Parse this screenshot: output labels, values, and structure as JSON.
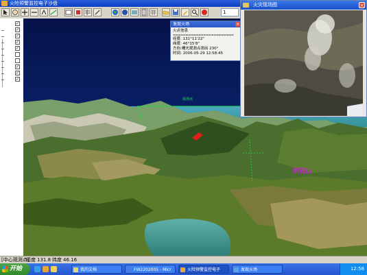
{
  "window": {
    "title": "火险预警监控电子沙盘"
  },
  "toolbar": {
    "zoom_value": "1",
    "icons": [
      "pointer-icon",
      "pan-icon",
      "zoom-in-icon",
      "zoom-out-icon",
      "rotate-icon",
      "measure-icon",
      "identify-icon",
      "select-icon",
      "globe-icon",
      "layers-icon",
      "photo-icon",
      "print-icon",
      "open-icon",
      "save-icon",
      "search-icon",
      "fly-icon",
      "record-icon",
      "help-icon"
    ]
  },
  "popup": {
    "title": "发现火场",
    "heading": "火点信息",
    "lines": [
      "经度: 131°11'22\"",
      "纬度: 46°15'8\"",
      "方向:曙光观测点测出 230°",
      "时间: 2006-05-29 12:58:45"
    ],
    "separator": "========================"
  },
  "photo_window": {
    "title": "火灾现场图"
  },
  "scene": {
    "label": "桃花山"
  },
  "statusbar": {
    "mode": "[中心观测点]",
    "lon_label": "经度",
    "lon_value": "131.8",
    "lat_label": "纬度",
    "lat_value": "46.16"
  },
  "taskbar": {
    "start_label": "开始",
    "tasks": [
      "我的文档",
      "FW2202005 - Micr",
      "火险预警监控电子",
      "发现火场"
    ],
    "clock": "12:58"
  },
  "colors": {
    "title_blue": "#0b3fc4",
    "taskbar_blue": "#2456d0",
    "label_magenta": "#d020d8"
  }
}
